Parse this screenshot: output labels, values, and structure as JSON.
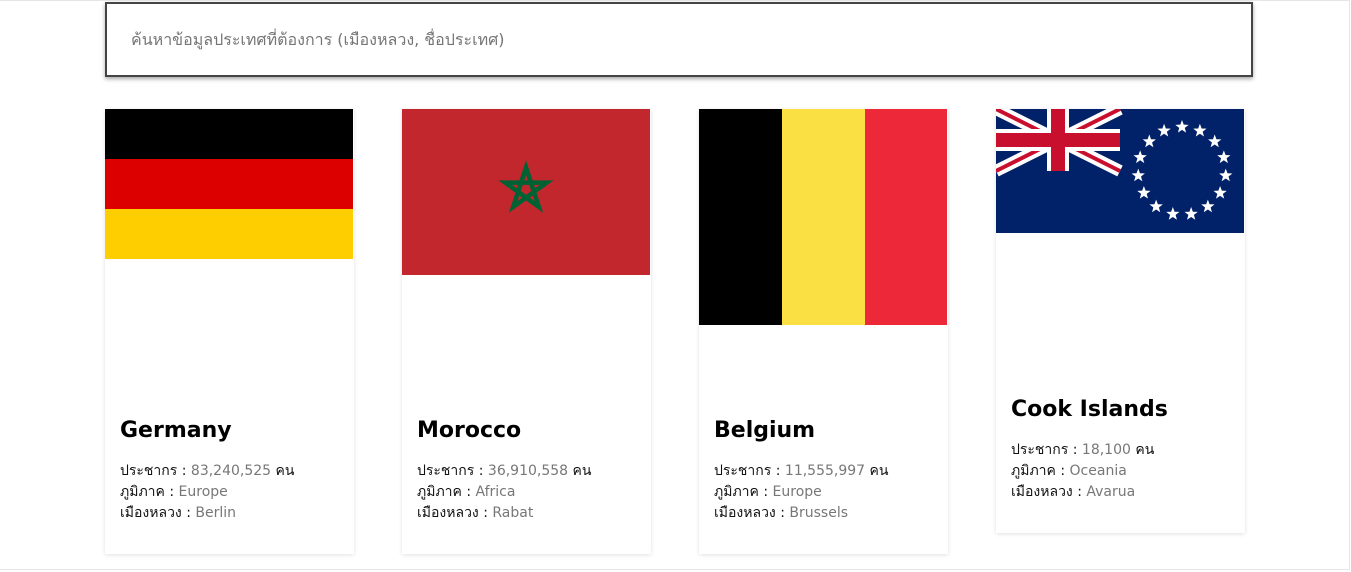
{
  "search": {
    "placeholder": "ค้นหาข้อมูลประเทศที่ต้องการ (เมืองหลวง, ชื่อประเทศ)",
    "value": ""
  },
  "labels": {
    "population": "ประชากร : ",
    "region": "ภูมิภาค : ",
    "capital": "เมืองหลวง : ",
    "people_unit": " คน"
  },
  "countries": [
    {
      "name": "Germany",
      "population": "83,240,525",
      "region": "Europe",
      "capital": "Berlin",
      "flag_colors": [
        "#000000",
        "#DD0000",
        "#FFCE00"
      ]
    },
    {
      "name": "Morocco",
      "population": "36,910,558",
      "region": "Africa",
      "capital": "Rabat",
      "flag_colors": [
        "#C1272D",
        "#006233"
      ]
    },
    {
      "name": "Belgium",
      "population": "11,555,997",
      "region": "Europe",
      "capital": "Brussels",
      "flag_colors": [
        "#000000",
        "#FAE042",
        "#ED2939"
      ]
    },
    {
      "name": "Cook Islands",
      "population": "18,100",
      "region": "Oceania",
      "capital": "Avarua",
      "flag_colors": [
        "#012169",
        "#FFFFFF",
        "#C8102E"
      ]
    }
  ]
}
